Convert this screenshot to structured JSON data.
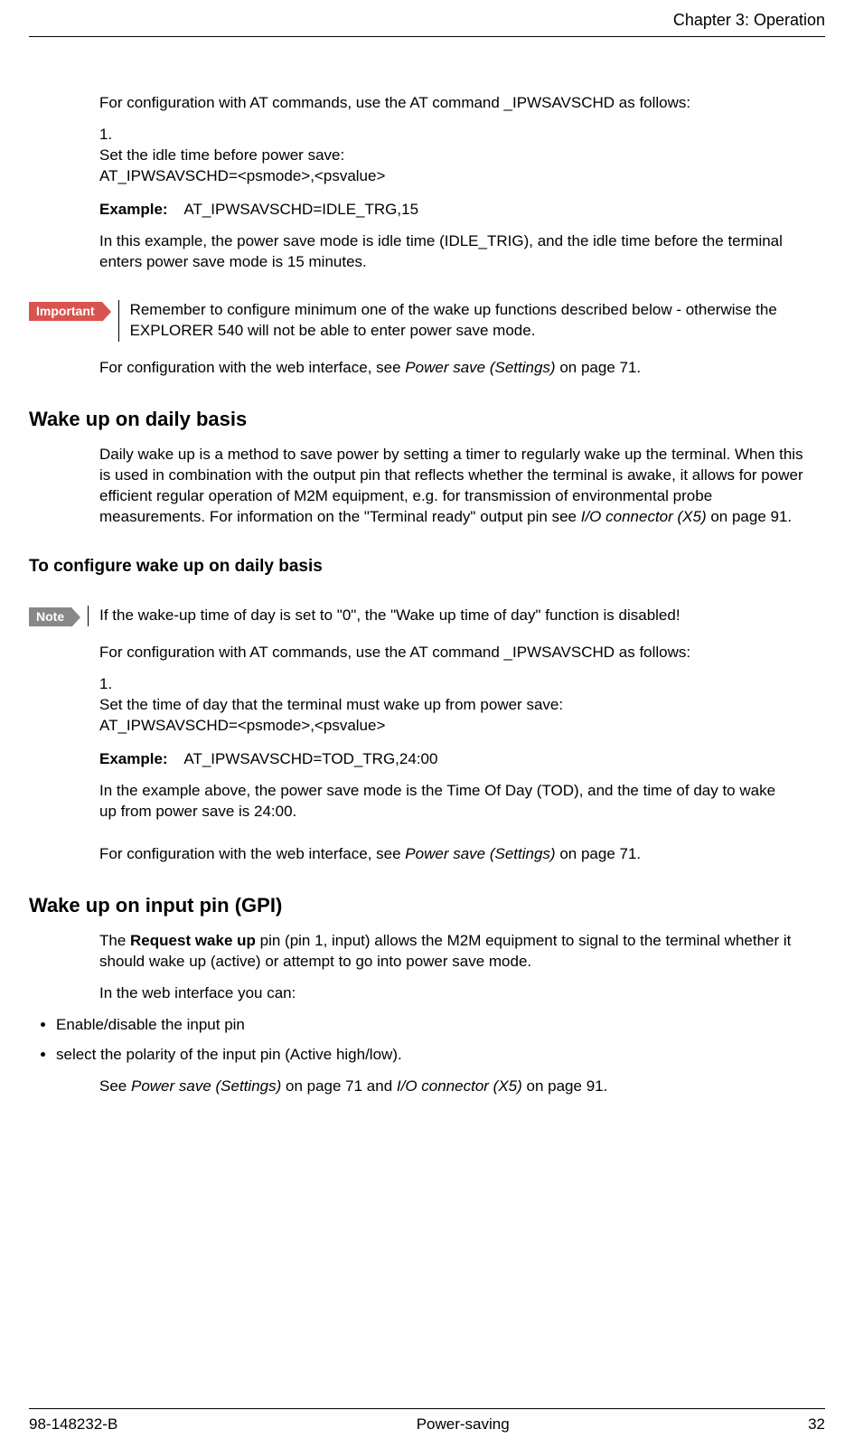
{
  "header": {
    "chapter": "Chapter 3: Operation"
  },
  "intro1": "For configuration with AT commands, use the AT command _IPWSAVSCHD as follows:",
  "list1": {
    "num": "1.",
    "line1": "Set the idle time before power save:",
    "line2": "AT_IPWSAVSCHD=<psmode>,<psvalue>",
    "example_label": "Example:",
    "example_text": "AT_IPWSAVSCHD=IDLE_TRG,15",
    "explain": "In this example, the power save mode is idle time (IDLE_TRIG), and the idle time before the terminal enters power save mode is 15 minutes."
  },
  "important": {
    "tag": "Important",
    "text": "Remember to configure minimum one of the wake up functions described below - otherwise the EXPLORER 540 will not be able to enter power save mode."
  },
  "after_important_pre": "For configuration with the web interface, see ",
  "after_important_link": "Power save (Settings)",
  "after_important_post": " on page 71.",
  "sect_daily": "Wake up on daily basis",
  "daily_para_pre": "Daily wake up is a method to save power by setting a timer to regularly wake up the terminal. When this is used in combination with the output pin that reflects whether the terminal is awake, it allows for power efficient regular operation of M2M equipment, e.g. for transmission of environmental probe measurements. For information on the \"Terminal ready\" output pin see ",
  "daily_para_link": "I/O connector (X5)",
  "daily_para_post": " on page 91.",
  "subsect_config_daily": "To configure wake up on daily basis",
  "note": {
    "tag": "Note",
    "text": "If the wake-up time of day is set to \"0\", the \"Wake up time of day\" function is disabled!"
  },
  "intro2": "For configuration with AT commands, use the AT command _IPWSAVSCHD as follows:",
  "list2": {
    "num": "1.",
    "line1": "Set the time of day that the terminal must wake up from power save:",
    "line2": "AT_IPWSAVSCHD=<psmode>,<psvalue>",
    "example_label": "Example:",
    "example_text": "AT_IPWSAVSCHD=TOD_TRG,24:00",
    "explain": "In the example above, the power save mode is the Time Of Day (TOD), and the time of day to wake up from power save is 24:00."
  },
  "after_note_pre": "For configuration with the web interface, see ",
  "after_note_link": "Power save (Settings)",
  "after_note_post": " on page 71.",
  "sect_gpi": "Wake up on input pin (GPI)",
  "gpi_para1_pre": "The ",
  "gpi_para1_bold": "Request wake up",
  "gpi_para1_post": " pin (pin 1, input) allows the M2M equipment to signal to the terminal whether it should wake up (active) or attempt to go into power save mode.",
  "gpi_para2": "In the web interface you can:",
  "gpi_bullets": {
    "b1": "Enable/disable the input pin",
    "b2": "select the polarity of the input pin (Active high/low)."
  },
  "gpi_see_pre": "See ",
  "gpi_see_link1": "Power save (Settings)",
  "gpi_see_mid": " on page 71 and ",
  "gpi_see_link2": "I/O connector (X5)",
  "gpi_see_post": " on page 91.",
  "footer": {
    "left": "98-148232-B",
    "center": "Power-saving",
    "right": "32"
  }
}
